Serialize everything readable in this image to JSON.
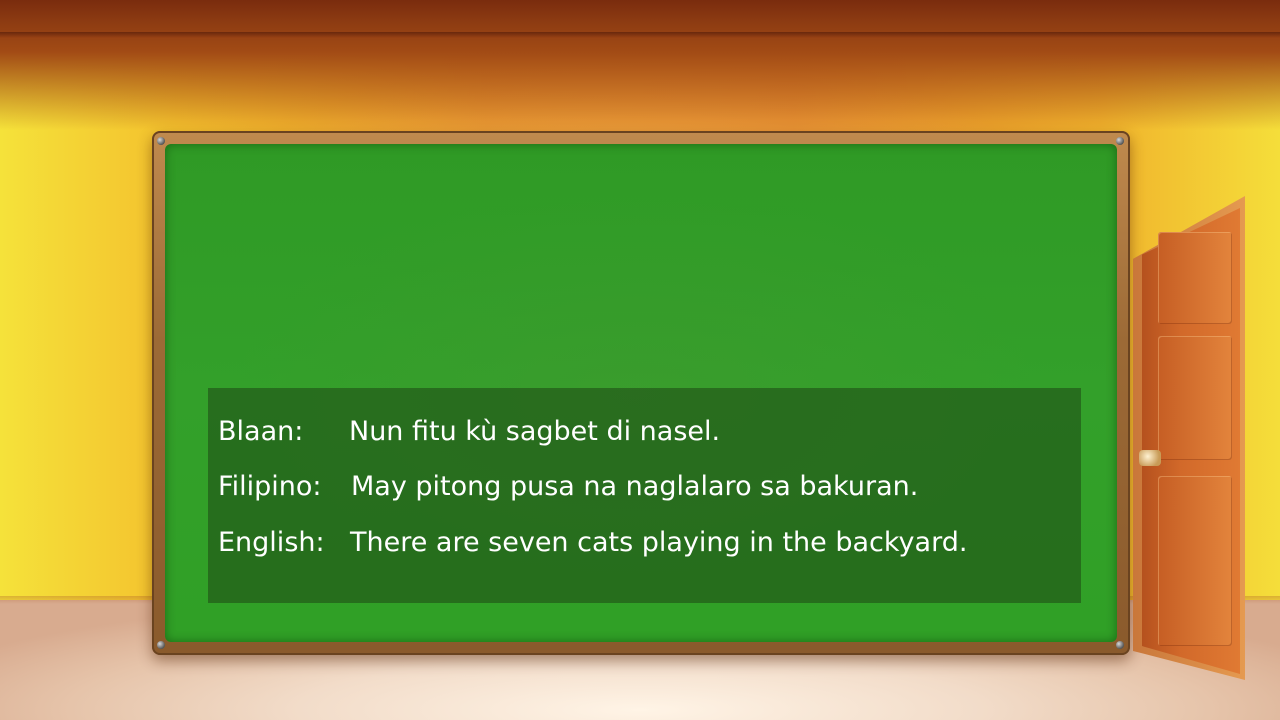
{
  "translations": [
    {
      "language": "Blaan:",
      "sentence": "Nun fitu kù sagbet di nasel."
    },
    {
      "language": "Filipino:",
      "sentence": "May pitong pusa na naglalaro sa bakuran."
    },
    {
      "language": "English:",
      "sentence": "There are seven cats playing in the backyard."
    }
  ],
  "colors": {
    "board": "#33a02a",
    "frame": "#9c6a36",
    "wall": "#e58a2a",
    "door": "#d2692a",
    "text": "#ffffff"
  }
}
